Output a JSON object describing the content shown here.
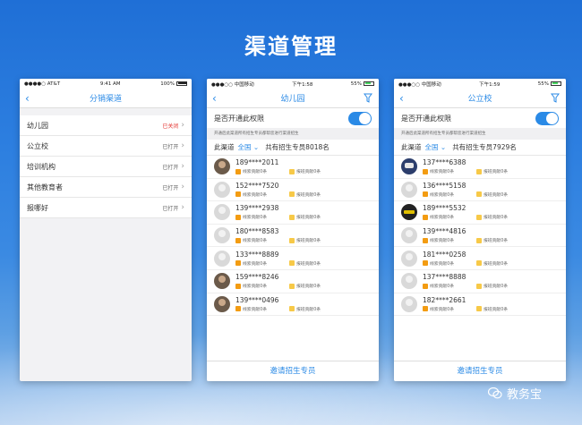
{
  "page_title": "渠道管理",
  "watermark": "教务宝",
  "screen1": {
    "status": {
      "carrier": "●●●●○ AT&T",
      "time": "9:41 AM",
      "battery": "100%"
    },
    "nav_title": "分销渠道",
    "rows": [
      {
        "label": "幼儿园",
        "status": "已关闭",
        "closed": true
      },
      {
        "label": "公立校",
        "status": "已打开",
        "closed": false
      },
      {
        "label": "培训机构",
        "status": "已打开",
        "closed": false
      },
      {
        "label": "其他教育者",
        "status": "已打开",
        "closed": false
      },
      {
        "label": "报哪好",
        "status": "已打开",
        "closed": false
      }
    ]
  },
  "screen2": {
    "status": {
      "carrier": "●●●○○ 中国移动",
      "time": "下午1:58",
      "battery": "55%"
    },
    "nav_title": "幼儿园",
    "perm_label": "是否开通此权限",
    "note": "开通后此渠道所有招生专员都帮您进行渠道招生",
    "channel_label": "此渠道",
    "scope": "全国",
    "count": "共有招生专员8018名",
    "stat1": "线索贡献0条",
    "stat2": "报班贡献0条",
    "items": [
      {
        "phone": "189****2011",
        "avatar": "photo"
      },
      {
        "phone": "152****7520",
        "avatar": "default"
      },
      {
        "phone": "139****2938",
        "avatar": "default"
      },
      {
        "phone": "180****8583",
        "avatar": "default"
      },
      {
        "phone": "133****8889",
        "avatar": "default"
      },
      {
        "phone": "159****8246",
        "avatar": "photo"
      },
      {
        "phone": "139****0496",
        "avatar": "photo"
      }
    ],
    "invite": "邀请招生专员"
  },
  "screen3": {
    "status": {
      "carrier": "●●●○○ 中国移动",
      "time": "下午1:59",
      "battery": "55%"
    },
    "nav_title": "公立校",
    "perm_label": "是否开通此权限",
    "note": "开通后此渠道所有招生专员都帮您进行渠道招生",
    "channel_label": "此渠道",
    "scope": "全国",
    "count": "共有招生专员7929名",
    "stat1": "线索贡献0条",
    "stat2": "报班贡献0条",
    "items": [
      {
        "phone": "137****6388",
        "avatar": "logo"
      },
      {
        "phone": "136****5158",
        "avatar": "default"
      },
      {
        "phone": "189****5532",
        "avatar": "dark"
      },
      {
        "phone": "139****4816",
        "avatar": "default"
      },
      {
        "phone": "181****0258",
        "avatar": "default"
      },
      {
        "phone": "137****8888",
        "avatar": "default"
      },
      {
        "phone": "182****2661",
        "avatar": "default"
      }
    ],
    "invite": "邀请招生专员"
  },
  "colors": {
    "accent": "#2a8ae6",
    "closed": "#e53935",
    "bg_top": "#1f6fd6"
  }
}
